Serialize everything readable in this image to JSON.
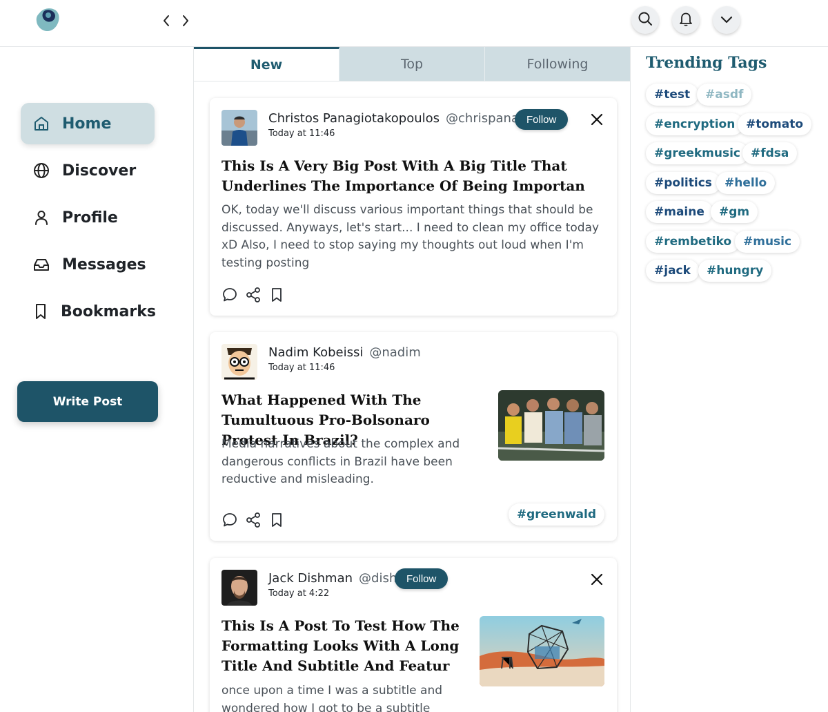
{
  "header": {
    "logo_icon": "app-logo",
    "back_icon": "chevron-left-icon",
    "forward_icon": "chevron-right-icon",
    "search_icon": "search-icon",
    "notifications_icon": "bell-icon",
    "menu_icon": "chevron-down-icon"
  },
  "sidebar": {
    "items": [
      {
        "label": "Home",
        "icon": "home-icon",
        "active": true
      },
      {
        "label": "Discover",
        "icon": "globe-icon"
      },
      {
        "label": "Profile",
        "icon": "user-icon"
      },
      {
        "label": "Messages",
        "icon": "inbox-icon"
      },
      {
        "label": "Bookmarks",
        "icon": "bookmark-icon"
      }
    ],
    "write_post": "Write Post"
  },
  "feed": {
    "tabs": [
      {
        "label": "New",
        "active": true
      },
      {
        "label": "Top"
      },
      {
        "label": "Following"
      }
    ],
    "posts": [
      {
        "name": "Christos Panagiotakopoulos",
        "handle": "@chrispanag",
        "time": "Today at 11:46",
        "follow": "Follow",
        "title": "This Is A Very Big Post With A Big Title That Underlines The Importance Of Being Importan",
        "body": "OK, today we'll discuss various important things that should be discussed. Anyways, let's start... I need to clean my office today xD Also, I need to stop saying my thoughts out loud when I'm testing posting"
      },
      {
        "name": "Nadim Kobeissi",
        "handle": "@nadim",
        "time": "Today at 11:46",
        "title": "What Happened With The Tumultuous Pro-Bolsonaro Protest In Brazil?",
        "body": "Media narratives about the complex and dangerous conflicts in Brazil have been reductive and misleading.",
        "tag": "#greenwald"
      },
      {
        "name": "Jack Dishman",
        "handle": "@dish",
        "time": "Today at 4:22",
        "follow": "Follow",
        "title": "This Is A Post To Test How The Formatting Looks With A Long Title And Subtitle And Featur",
        "body": "once upon a time I was a subtitle and wondered how I got to be a subtitle rather"
      }
    ]
  },
  "trending": {
    "title": "Trending Tags",
    "tags": [
      "#test",
      "#asdf",
      "#encryption",
      "#tomato",
      "#greekmusic",
      "#fdsa",
      "#politics",
      "#hello",
      "#maine",
      "#gm",
      "#rembetiko",
      "#music",
      "#jack",
      "#hungry"
    ],
    "colors": {
      "dark": "#1c4a7a",
      "teal": "#1f6a80",
      "muted": "#8fb7c2",
      "blue": "#2f6f9a"
    }
  }
}
